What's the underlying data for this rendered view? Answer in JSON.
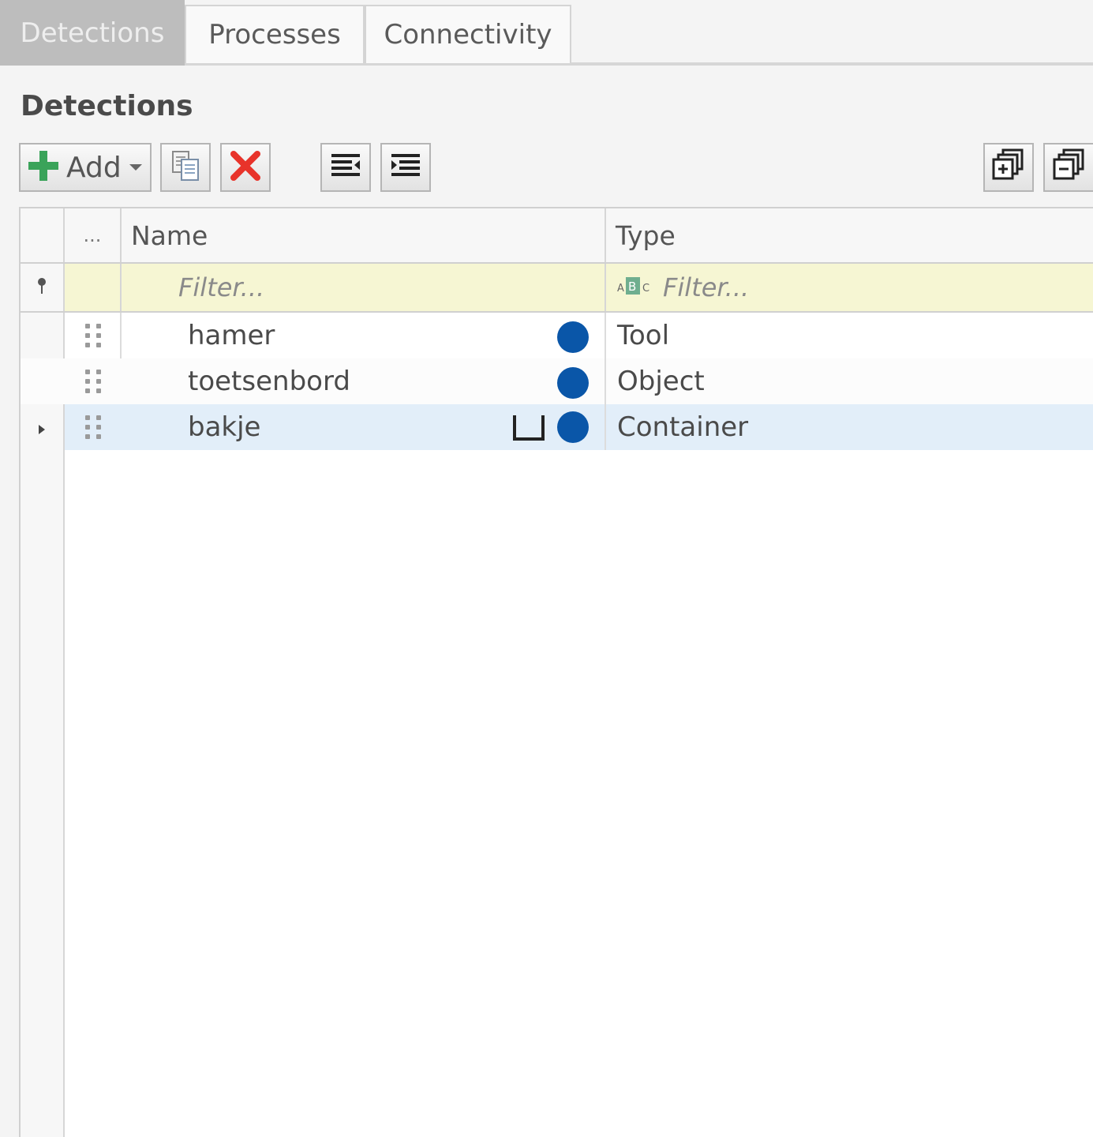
{
  "tabs": [
    {
      "label": "Detections",
      "active": true
    },
    {
      "label": "Processes",
      "active": false
    },
    {
      "label": "Connectivity",
      "active": false
    }
  ],
  "section": {
    "title": "Detections"
  },
  "toolbar": {
    "add_label": "Add",
    "icons": [
      "plus-icon",
      "copy-icon",
      "delete-icon",
      "outdent-icon",
      "indent-icon",
      "expand-all-icon",
      "collapse-all-icon"
    ]
  },
  "grid": {
    "columns": {
      "extra": "...",
      "name": "Name",
      "type": "Type"
    },
    "filter": {
      "name_placeholder": "Filter...",
      "type_placeholder": "Filter..."
    },
    "rows": [
      {
        "name": "hamer",
        "type": "Tool",
        "has_container_icon": false,
        "expandable": false,
        "selected": false
      },
      {
        "name": "toetsenbord",
        "type": "Object",
        "has_container_icon": false,
        "expandable": false,
        "selected": false
      },
      {
        "name": "bakje",
        "type": "Container",
        "has_container_icon": true,
        "expandable": true,
        "selected": true
      }
    ]
  },
  "colors": {
    "status_dot": "#0a56a8",
    "add_plus": "#3aa35a",
    "delete_x": "#e8332a",
    "filter_row": "#f6f6d3",
    "selected_row": "#e2eef9",
    "active_tab": "#bdbdbd"
  }
}
